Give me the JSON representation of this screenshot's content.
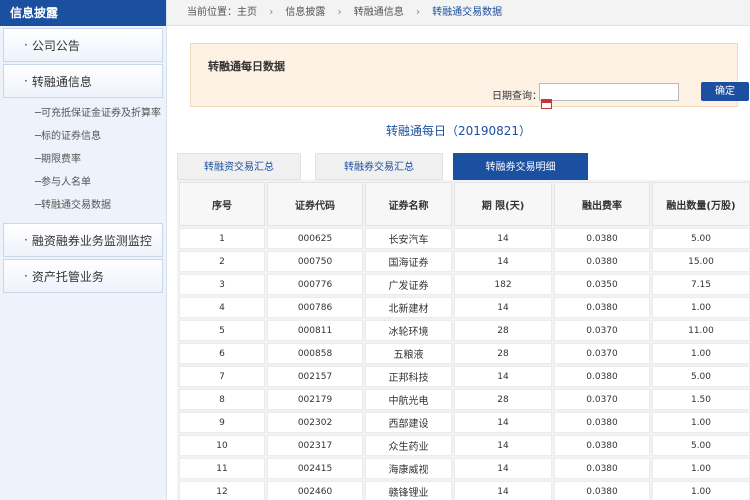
{
  "sidebar": {
    "header": "信息披露",
    "sections": [
      {
        "label": "公司公告"
      },
      {
        "label": "转融通信息"
      }
    ],
    "sub_items": [
      "─可充抵保证金证券及折算率",
      "─标的证券信息",
      "─期限费率",
      "─参与人名单",
      "─转融通交易数据"
    ],
    "bottom_sections": [
      {
        "label": "融资融券业务监测监控"
      },
      {
        "label": "资产托管业务"
      }
    ],
    "bullet": "·"
  },
  "breadcrumb": {
    "prefix": "当前位置：",
    "items": [
      "主页",
      "信息披露",
      "转融通信息"
    ],
    "current": "转融通交易数据",
    "sep": "›"
  },
  "query": {
    "title": "转融通每日数据",
    "label": "日期查询：",
    "date_value": "",
    "button": "确定"
  },
  "day_title": "转融通每日（20190821）",
  "tabs": [
    {
      "label": "转融资交易汇总",
      "active": false
    },
    {
      "label": "转融券交易汇总",
      "active": false
    },
    {
      "label": "转融券交易明细",
      "active": true
    }
  ],
  "table": {
    "headers": [
      "序号",
      "证券代码",
      "证券名称",
      "期 限(天)",
      "融出费率",
      "融出数量(万股)"
    ],
    "rows": [
      [
        "1",
        "000625",
        "长安汽车",
        "14",
        "0.0380",
        "5.00"
      ],
      [
        "2",
        "000750",
        "国海证券",
        "14",
        "0.0380",
        "15.00"
      ],
      [
        "3",
        "000776",
        "广发证券",
        "182",
        "0.0350",
        "7.15"
      ],
      [
        "4",
        "000786",
        "北新建材",
        "14",
        "0.0380",
        "1.00"
      ],
      [
        "5",
        "000811",
        "冰轮环境",
        "28",
        "0.0370",
        "11.00"
      ],
      [
        "6",
        "000858",
        "五粮液",
        "28",
        "0.0370",
        "1.00"
      ],
      [
        "7",
        "002157",
        "正邦科技",
        "14",
        "0.0380",
        "5.00"
      ],
      [
        "8",
        "002179",
        "中航光电",
        "28",
        "0.0370",
        "1.50"
      ],
      [
        "9",
        "002302",
        "西部建设",
        "14",
        "0.0380",
        "1.00"
      ],
      [
        "10",
        "002317",
        "众生药业",
        "14",
        "0.0380",
        "5.00"
      ],
      [
        "11",
        "002415",
        "海康威视",
        "14",
        "0.0380",
        "1.00"
      ],
      [
        "12",
        "002460",
        "赣锋锂业",
        "14",
        "0.0380",
        "1.00"
      ]
    ]
  }
}
